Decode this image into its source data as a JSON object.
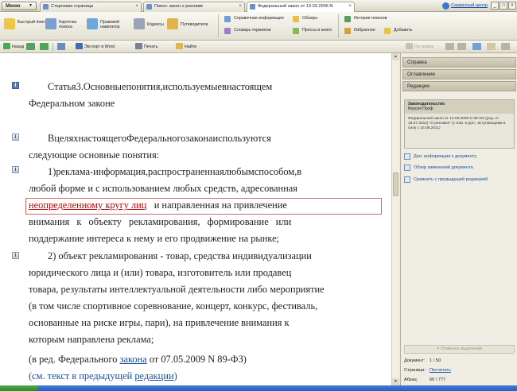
{
  "tabbar": {
    "menu_label": "Меню",
    "tabs": [
      {
        "label": "Стартовая страница",
        "active": false
      },
      {
        "label": "Поиск: закон о рекламе",
        "active": false
      },
      {
        "label": "Федеральный закон от 13.03.2006 N",
        "active": true
      }
    ],
    "service_center": "Сервисный центр"
  },
  "ribbon": {
    "quick_search": "Быстрый поиск",
    "card_search": "Карточка поиска",
    "legal_navigator": "Правовой навигатор",
    "codes": "Кодексы",
    "guides": "Путеводители",
    "reference_info": "Справочная информация",
    "term_dictionary": "Словарь терминов",
    "reviews": "Обзоры",
    "press_books": "Пресса и книги",
    "search_history": "История поисков",
    "favorites": "Избранное",
    "add": "Добавить"
  },
  "toolbar": {
    "back": "Назад",
    "export_word": "Экспорт в Word",
    "print": "Печать",
    "find": "Найти",
    "prev_hit": "По списку"
  },
  "document": {
    "article_title": [
      "Статья 3. Основные понятия, используемые в настоящем",
      "Федеральном законе"
    ],
    "intro": [
      "В целях настоящего Федерального закона используются",
      "следующие основные понятия:"
    ],
    "item1_line1": "1) реклама - информация, распространенная любым способом, в",
    "item1_line2": "любой форме и с использованием любых средств, адресованная",
    "item1_highlight": "неопределенному кругу лиц",
    "item1_line3_rest": "и направленная на привлечение",
    "item1_line4": "внимания к объекту рекламирования, формирование или",
    "item1_line5": "поддержание интереса к нему и его продвижение на рынке;",
    "item2_lines": [
      "2) объект рекламирования - товар, средства индивидуализации",
      "юридического лица и (или) товара, изготовитель или продавец",
      "товара, результаты интеллектуальной деятельности либо мероприятие",
      "(в том числе спортивное соревнование, концерт, конкурс, фестиваль,",
      "основанные на риске игры, пари), на привлечение внимания к",
      "которым направлена реклама;"
    ],
    "edition_prefix": "(в ред. Федерального",
    "edition_link": "закона",
    "edition_suffix": "от 07.05.2009 N 89-ФЗ)",
    "see_prefix": "(см. текст в предыдущей",
    "see_link": "редакции",
    "see_suffix": ")"
  },
  "right_panel": {
    "tabs": [
      "Справка",
      "Оглавление",
      "Редакции"
    ],
    "info_header_title": "Законодательство",
    "info_header_sub": "Версия Проф",
    "info_body": "Федеральный закон от 13.03.2006 N 38-ФЗ (ред. от 18.07.2011) \"О рекламе\" (с изм. и доп., вступающими в силу с 15.08.2011)",
    "links": [
      "Доп. информация к документу",
      "Обзор изменений документа",
      "Сравнить с предыдущей редакцией"
    ],
    "unmark": "Отменить выделение",
    "stats": {
      "document_label": "Документ:",
      "document_value": "1 / 50",
      "page_label": "Страница:",
      "page_value": "Посчитать",
      "paragraph_label": "Абзац:",
      "paragraph_value": "60 / 777"
    }
  },
  "colors": {
    "highlight": "#c00000",
    "link": "#1a4fa0",
    "panel_bg": "#eeece3"
  }
}
